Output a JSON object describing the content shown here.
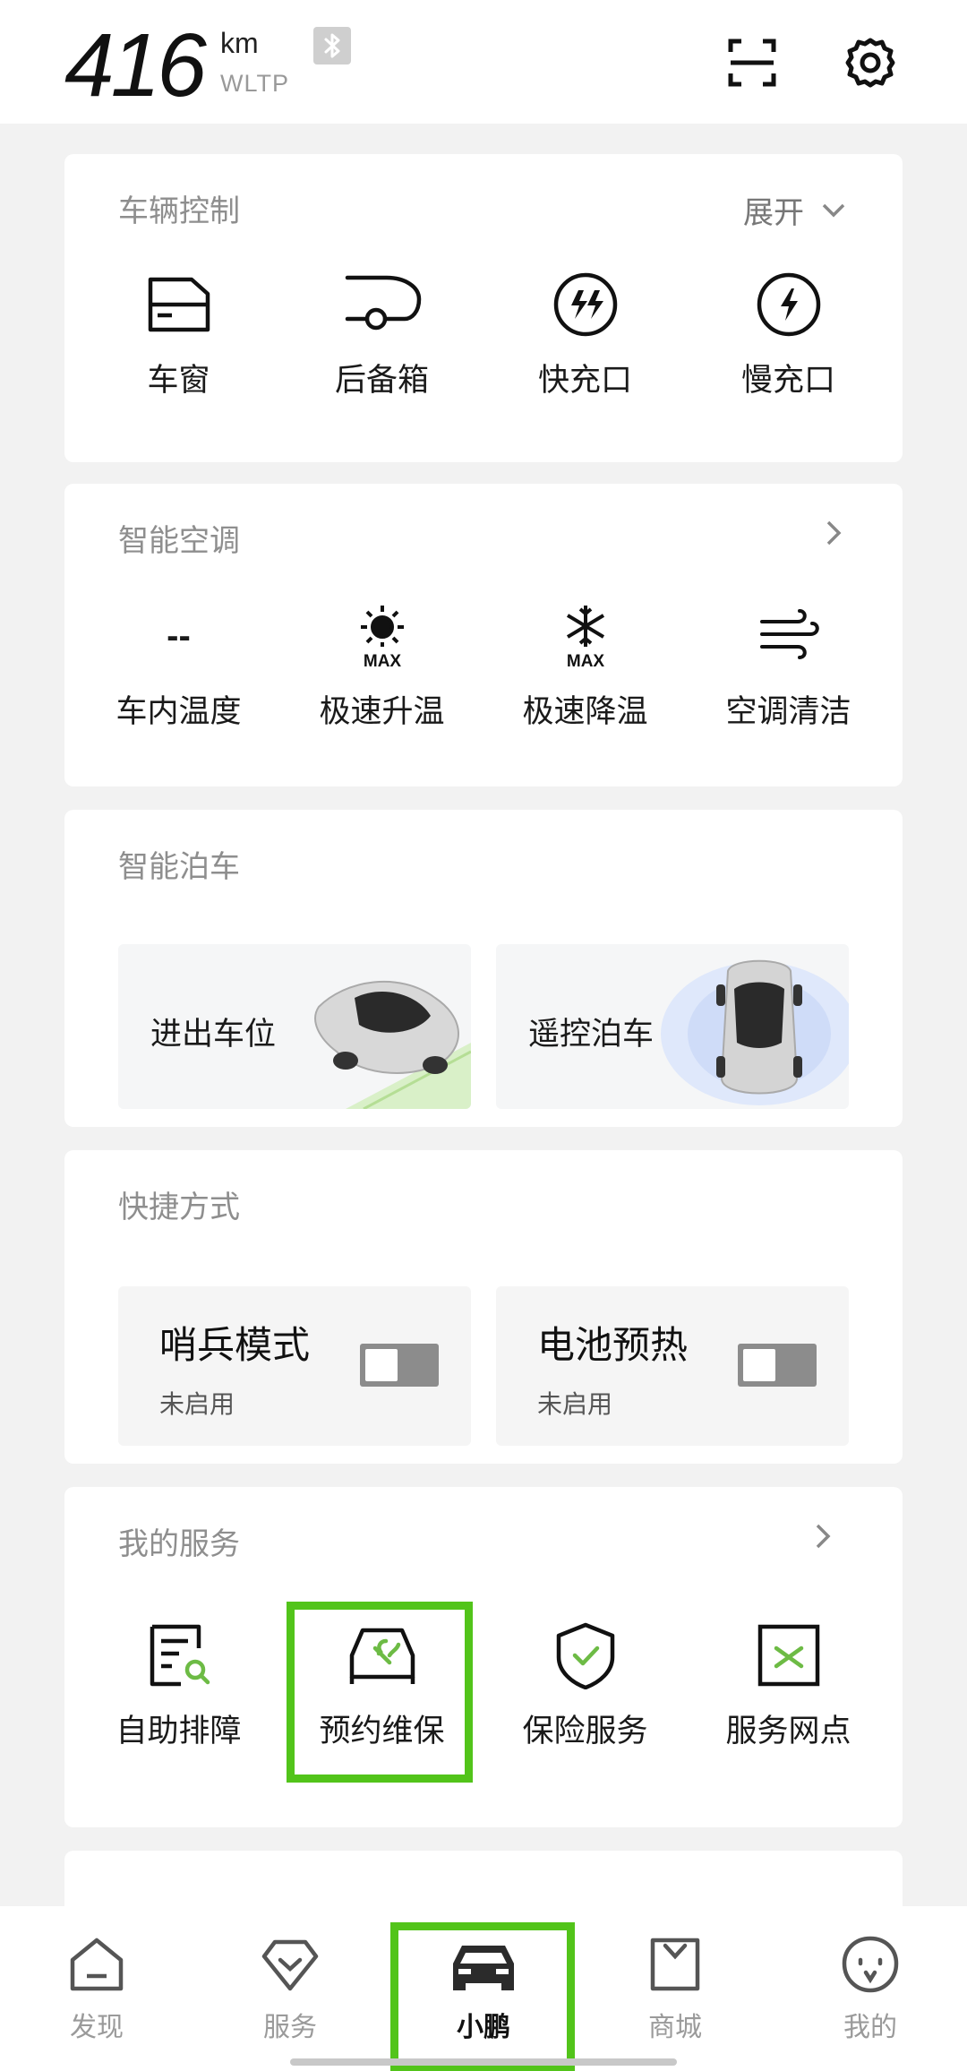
{
  "header": {
    "range_value": "416",
    "range_unit": "km",
    "range_standard": "WLTP",
    "icons": [
      "bluetooth-icon",
      "scan-icon",
      "gear-icon"
    ]
  },
  "vehicle_control": {
    "title": "车辆控制",
    "action_label": "展开",
    "items": [
      {
        "label": "车窗",
        "icon": "window-icon"
      },
      {
        "label": "后备箱",
        "icon": "trunk-icon"
      },
      {
        "label": "快充口",
        "icon": "fast-charge-port-icon"
      },
      {
        "label": "慢充口",
        "icon": "slow-charge-port-icon"
      }
    ]
  },
  "climate": {
    "title": "智能空调",
    "items": [
      {
        "label": "车内温度",
        "value": "--"
      },
      {
        "label": "极速升温",
        "icon": "sun-max-icon",
        "badge": "MAX"
      },
      {
        "label": "极速降温",
        "icon": "snowflake-max-icon",
        "badge": "MAX"
      },
      {
        "label": "空调清洁",
        "icon": "wind-icon"
      }
    ]
  },
  "parking": {
    "title": "智能泊车",
    "items": [
      {
        "label": "进出车位"
      },
      {
        "label": "遥控泊车"
      }
    ]
  },
  "shortcuts": {
    "title": "快捷方式",
    "items": [
      {
        "title": "哨兵模式",
        "status": "未启用",
        "enabled": false
      },
      {
        "title": "电池预热",
        "status": "未启用",
        "enabled": false
      }
    ]
  },
  "services": {
    "title": "我的服务",
    "items": [
      {
        "label": "自助排障",
        "icon": "diagnose-icon"
      },
      {
        "label": "预约维保",
        "icon": "maintenance-icon"
      },
      {
        "label": "保险服务",
        "icon": "insurance-icon"
      },
      {
        "label": "服务网点",
        "icon": "service-outlet-icon"
      }
    ]
  },
  "tabbar": {
    "items": [
      {
        "label": "发现",
        "icon": "home-icon",
        "active": false
      },
      {
        "label": "服务",
        "icon": "service-icon",
        "active": false
      },
      {
        "label": "小鹏",
        "icon": "car-icon",
        "active": true
      },
      {
        "label": "商城",
        "icon": "bag-icon",
        "active": false
      },
      {
        "label": "我的",
        "icon": "profile-icon",
        "active": false
      }
    ]
  },
  "colors": {
    "highlight": "#52c41a",
    "accent_green": "#6dbb45",
    "background": "#f2f2f2"
  }
}
